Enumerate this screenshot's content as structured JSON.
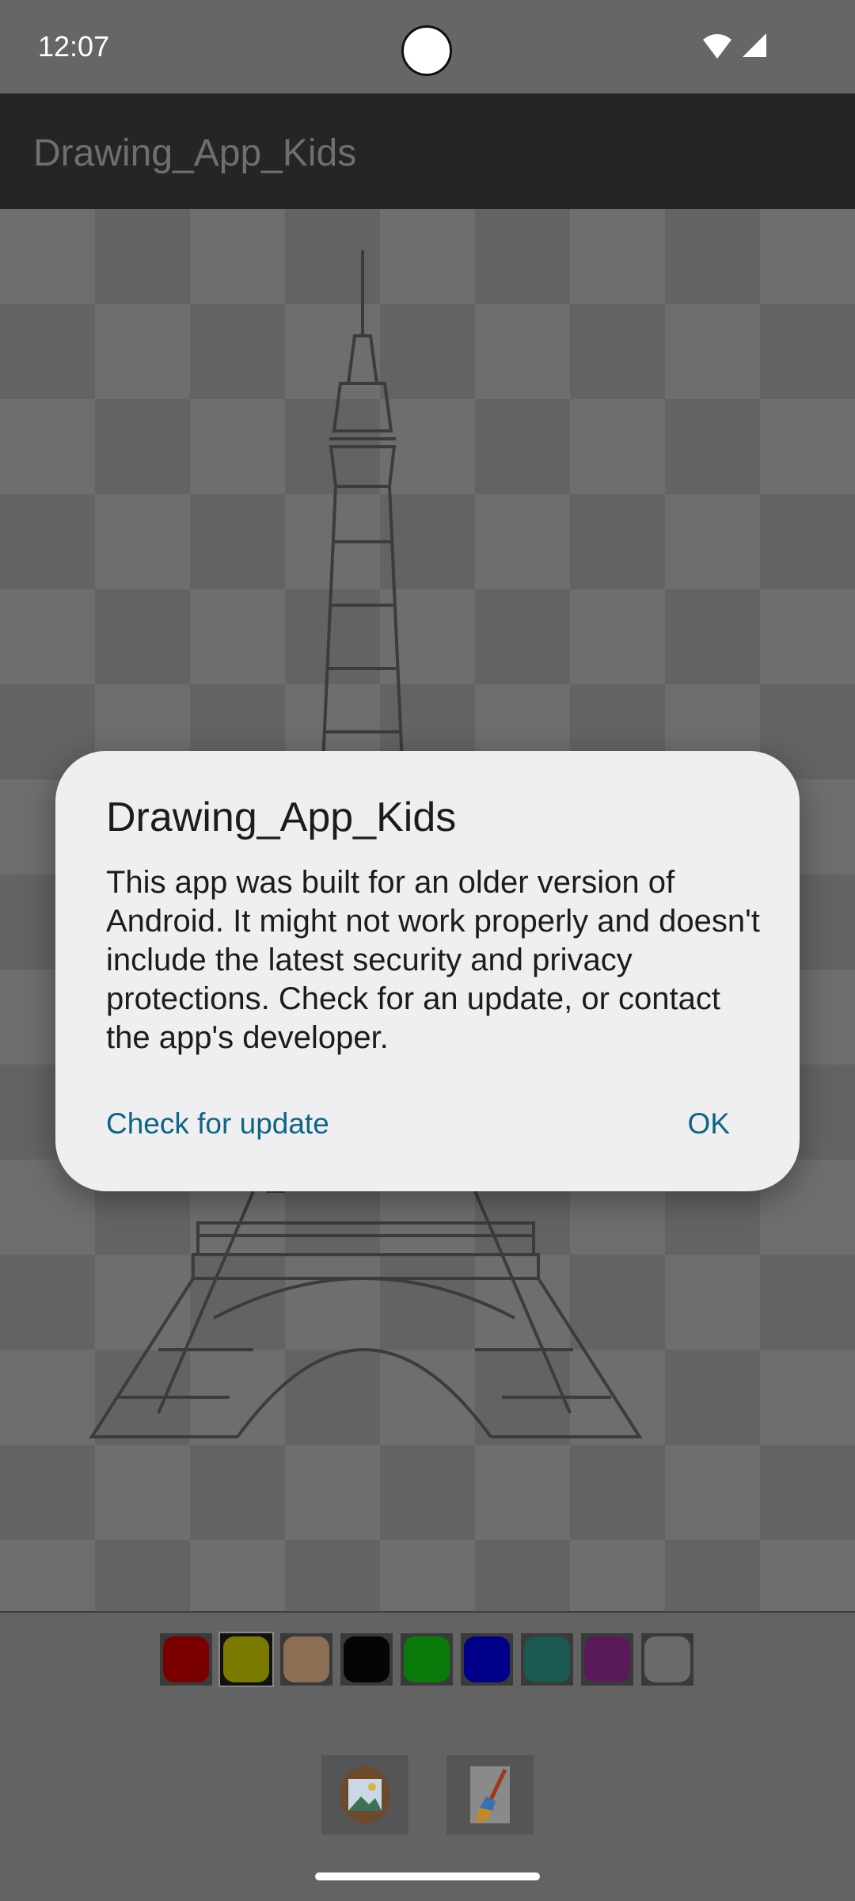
{
  "status_bar": {
    "time": "12:07",
    "icons": [
      "wifi-icon",
      "cellular-signal-icon"
    ]
  },
  "app_bar": {
    "title": "Drawing_App_Kids"
  },
  "canvas": {
    "picture": "eiffel-tower-outline"
  },
  "palette": {
    "colors": [
      {
        "name": "red",
        "hex": "#7a0000"
      },
      {
        "name": "yellow",
        "hex": "#7a7a00"
      },
      {
        "name": "tan",
        "hex": "#8c6e54"
      },
      {
        "name": "black",
        "hex": "#050505"
      },
      {
        "name": "green",
        "hex": "#0a7a0a"
      },
      {
        "name": "blue",
        "hex": "#000088"
      },
      {
        "name": "teal",
        "hex": "#1a5850"
      },
      {
        "name": "purple",
        "hex": "#5a1a5a"
      },
      {
        "name": "white",
        "hex": "#6a6a6a"
      }
    ],
    "selected_index": 1
  },
  "tools": {
    "gallery_icon": "image-gallery-icon",
    "brush_icon": "paint-brush-icon"
  },
  "dialog": {
    "title": "Drawing_App_Kids",
    "message": "This app was built for an older version of Android. It might not work properly and doesn't include the latest security and privacy protections. Check for an update, or contact the app's developer.",
    "secondary_button": "Check for update",
    "primary_button": "OK",
    "accent_color": "#0e6585"
  }
}
